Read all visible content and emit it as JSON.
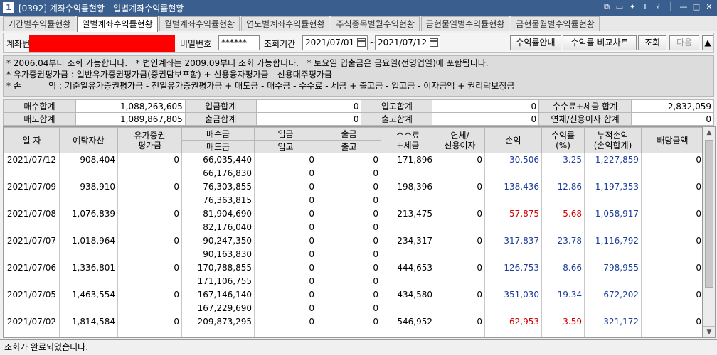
{
  "window": {
    "number": "1",
    "title": "[0392] 계좌수익률현황 - 일별계좌수익률현황"
  },
  "tabs": [
    "기간별수익률현황",
    "일별계좌수익률현황",
    "월별계좌수익률현황",
    "연도별계좌수익률현황",
    "주식종목별월수익현황",
    "금현물일별수익률현황",
    "금현물월별수익률현황"
  ],
  "form": {
    "account_label": "계좌번",
    "password_label": "비밀번호",
    "password_value": "******",
    "period_label": "조회기간",
    "date_from": "2021/07/01",
    "tilde": "~",
    "date_to": "2021/07/12",
    "btn_guide": "수익률안내",
    "btn_compare": "수익률 비교차트",
    "btn_query": "조회",
    "btn_next": "다음",
    "btn_collapse": "▲"
  },
  "notes": {
    "line1": "* 2006.04부터 조회 가능합니다.   * 법인계좌는 2009.09부터 조회 가능합니다.   * 토요일 입출금은 금요일(전영업일)에 포함됩니다.",
    "line2": "* 유가증권평가금 : 일반유가증권평가금(증권담보포함) + 신용융자평가금 - 신용대주평가금",
    "line3": "* 손          익 : 기준일유가증권평가금 - 전일유가증권평가금 + 매도금 - 매수금 - 수수료 - 세금 + 출고금 - 입고금 - 이자금액 + 권리락보정금"
  },
  "summary": {
    "buy_total_label": "매수합계",
    "buy_total": "1,088,263,605",
    "in_total_label": "입금합계",
    "in_total": "0",
    "stockin_total_label": "입고합계",
    "stockin_total": "0",
    "fee_tax_label": "수수료+세금 합계",
    "fee_tax": "2,832,059",
    "sell_total_label": "매도합계",
    "sell_total": "1,089,867,805",
    "out_total_label": "출금합계",
    "out_total": "0",
    "stockout_total_label": "출고합계",
    "stockout_total": "0",
    "interest_label": "연체/신용이자 합계",
    "interest": "0"
  },
  "headers": {
    "date": "일 자",
    "deposit": "예탁자산",
    "securities": "유가증권\n평가금",
    "buy": "매수금",
    "sell": "매도금",
    "deposit_in": "입금",
    "stock_in": "입고",
    "withdraw": "출금",
    "stock_out": "출고",
    "fee": "수수료\n+세금",
    "interest": "연체/\n신용이자",
    "pnl": "손익",
    "rate": "수익률\n(%)",
    "cum_pnl": "누적손익\n(손익합계)",
    "dividend": "배당금액"
  },
  "rows": [
    {
      "date": "2021/07/12",
      "deposit": "908,404",
      "securities": "0",
      "buy": "66,035,440",
      "sell": "66,176,830",
      "in": "0",
      "stock_in": "0",
      "out": "0",
      "stock_out": "0",
      "fee": "171,896",
      "interest": "0",
      "pnl": "-30,506",
      "rate": "-3.25",
      "cum": "-1,227,859",
      "div": "0"
    },
    {
      "date": "2021/07/09",
      "deposit": "938,910",
      "securities": "0",
      "buy": "76,303,855",
      "sell": "76,363,815",
      "in": "0",
      "stock_in": "0",
      "out": "0",
      "stock_out": "0",
      "fee": "198,396",
      "interest": "0",
      "pnl": "-138,436",
      "rate": "-12.86",
      "cum": "-1,197,353",
      "div": "0"
    },
    {
      "date": "2021/07/08",
      "deposit": "1,076,839",
      "securities": "0",
      "buy": "81,904,690",
      "sell": "82,176,040",
      "in": "0",
      "stock_in": "0",
      "out": "0",
      "stock_out": "0",
      "fee": "213,475",
      "interest": "0",
      "pnl": "57,875",
      "rate": "5.68",
      "cum": "-1,058,917",
      "div": "0"
    },
    {
      "date": "2021/07/07",
      "deposit": "1,018,964",
      "securities": "0",
      "buy": "90,247,350",
      "sell": "90,163,830",
      "in": "0",
      "stock_in": "0",
      "out": "0",
      "stock_out": "0",
      "fee": "234,317",
      "interest": "0",
      "pnl": "-317,837",
      "rate": "-23.78",
      "cum": "-1,116,792",
      "div": "0"
    },
    {
      "date": "2021/07/06",
      "deposit": "1,336,801",
      "securities": "0",
      "buy": "170,788,855",
      "sell": "171,106,755",
      "in": "0",
      "stock_in": "0",
      "out": "0",
      "stock_out": "0",
      "fee": "444,653",
      "interest": "0",
      "pnl": "-126,753",
      "rate": "-8.66",
      "cum": "-798,955",
      "div": "0"
    },
    {
      "date": "2021/07/05",
      "deposit": "1,463,554",
      "securities": "0",
      "buy": "167,146,140",
      "sell": "167,229,690",
      "in": "0",
      "stock_in": "0",
      "out": "0",
      "stock_out": "0",
      "fee": "434,580",
      "interest": "0",
      "pnl": "-351,030",
      "rate": "-19.34",
      "cum": "-672,202",
      "div": "0"
    },
    {
      "date": "2021/07/02",
      "deposit": "1,814,584",
      "securities": "0",
      "buy": "209,873,295",
      "sell": "",
      "in": "0",
      "stock_in": "",
      "out": "0",
      "stock_out": "",
      "fee": "546,952",
      "interest": "0",
      "pnl": "62,953",
      "rate": "3.59",
      "cum": "-321,172",
      "div": "0"
    }
  ],
  "status_text": "조회가 완료되었습니다.",
  "colors": {
    "negative": "#1c3c9c",
    "positive": "#d00000",
    "titlebar": "#3a5f8f"
  }
}
